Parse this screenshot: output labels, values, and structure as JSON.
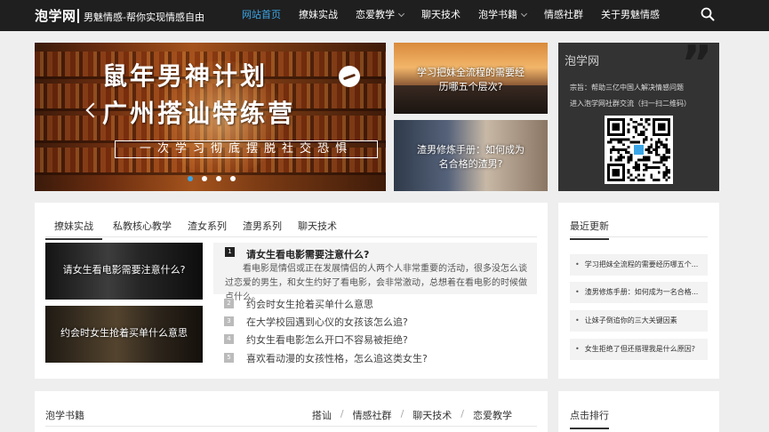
{
  "header": {
    "logo": "泡学网",
    "slogan": "男魅情感-帮你实现情感自由",
    "nav": [
      {
        "label": "网站首页",
        "active": true,
        "caret": false
      },
      {
        "label": "撩妹实战",
        "active": false,
        "caret": false
      },
      {
        "label": "恋爱教学",
        "active": false,
        "caret": true
      },
      {
        "label": "聊天技术",
        "active": false,
        "caret": false
      },
      {
        "label": "泡学书籍",
        "active": false,
        "caret": true
      },
      {
        "label": "情感社群",
        "active": false,
        "caret": false
      },
      {
        "label": "关于男魅情感",
        "active": false,
        "caret": false
      }
    ],
    "accent": "#3aa5e6"
  },
  "carousel": {
    "title1": "鼠年男神计划",
    "title2": "广州搭讪特练营",
    "subtitle": "一次学习彻底摆脱社交恐惧",
    "slides": 4,
    "active_slide": 0
  },
  "tiles": [
    {
      "caption": "学习把妹全流程的需要经历哪五个层次?"
    },
    {
      "caption": "渣男修炼手册：如何成为名合格的渣男?"
    }
  ],
  "qr_card": {
    "title": "泡学网",
    "line1": "宗旨：帮助三亿中国人解决情感问题",
    "line2": "进入泡学网社群交流（扫一扫二维码）"
  },
  "main": {
    "tabs": [
      "撩妹实战",
      "私教核心教学",
      "渣女系列",
      "渣男系列",
      "聊天技术"
    ],
    "thumbs": [
      {
        "caption": "请女生看电影需要注意什么?"
      },
      {
        "caption": "约会时女生抢着买单什么意思"
      }
    ],
    "featured": {
      "num": "1",
      "title": "请女生看电影需要注意什么?",
      "desc": "看电影是情侣或正在发展情侣的人两个人非常重要的活动，很多没怎么谈过恋爱的男生，和女生约好了看电影，会非常激动，总想着在看电影的时候做点什么。"
    },
    "list": [
      {
        "num": "2",
        "text": "约会时女生抢着买单什么意思"
      },
      {
        "num": "3",
        "text": "在大学校园遇到心仪的女孩该怎么追?"
      },
      {
        "num": "4",
        "text": "约女生看电影怎么开口不容易被拒绝?"
      },
      {
        "num": "5",
        "text": "喜欢看动漫的女孩性格，怎么追这类女生?"
      }
    ]
  },
  "latest": {
    "title": "最近更新",
    "items": [
      "学习把妹全流程的需要经历哪五个...",
      "渣男修炼手册：如何成为一名合格...",
      "让妹子倒追你的三大关键因素",
      "女生拒绝了但还搭理我是什么原因?"
    ]
  },
  "books": {
    "title": "泡学书籍",
    "links": [
      "搭讪",
      "情感社群",
      "聊天技术",
      "恋爱教学"
    ],
    "sep": "/"
  },
  "rank": {
    "title": "点击排行"
  }
}
